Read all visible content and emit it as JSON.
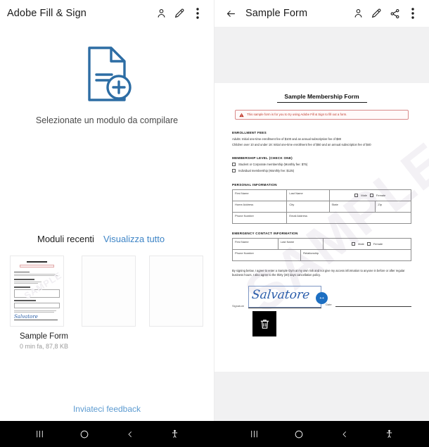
{
  "left_app": {
    "title": "Adobe Fill & Sign",
    "icons": [
      "person-icon",
      "pen-icon",
      "overflow-menu-icon"
    ],
    "empty_state": {
      "icon": "document-add-icon",
      "message": "Selezionate un modulo da compilare",
      "icon_color": "#2d6da4"
    },
    "recent": {
      "title": "Moduli recenti",
      "view_all": "Visualizza tutto",
      "link_color": "#3d84c6",
      "cards": [
        {
          "name": "Sample Form",
          "meta": "0 min fa, 87,8 KB",
          "has_thumbnail": true
        },
        {
          "name": "",
          "meta": "",
          "has_thumbnail": false
        },
        {
          "name": "",
          "meta": "",
          "has_thumbnail": false
        }
      ]
    },
    "feedback_link": "Inviateci feedback"
  },
  "right_app": {
    "back_icon": "back-arrow-icon",
    "title": "Sample Form",
    "icons": [
      "person-icon",
      "pen-icon",
      "share-icon",
      "overflow-menu-icon"
    ],
    "document": {
      "watermark": "SAMPLE",
      "title": "Sample Membership Form",
      "alert": {
        "icon": "warning-triangle-icon",
        "text": "This sample form is for you to try using Adobe Fill & Sign to fill out a form.",
        "color": "#c0392b"
      },
      "enrollment": {
        "heading": "ENROLLMENT FEES",
        "lines": [
          "Adults: Initial one-time enrollment fee of $100 and an annual subscription fee of $80",
          "Children over 10 and under 18: Initial one-time enrollment fee of $50 and an annual subscription fee of $40"
        ]
      },
      "membership": {
        "heading": "MEMBERSHIP LEVEL (CHECK ONE)",
        "options": [
          "Student or Corporate membership (Monthly fee: $75)",
          "Individual membership (Monthly fee: $125)"
        ]
      },
      "personal": {
        "heading": "PERSONAL INFORMATION",
        "fields": {
          "first_name": "First Name",
          "last_name": "Last Name",
          "male": "Male",
          "female": "Female",
          "home_address": "Home Address",
          "city": "City",
          "state": "State",
          "zip": "Zip",
          "phone": "Phone Number",
          "email": "Email Address"
        }
      },
      "emergency": {
        "heading": "EMERGENCY CONTACT INFORMATION",
        "fields": {
          "first_name": "First Name",
          "last_name": "Last Name",
          "male": "Male",
          "female": "Female",
          "phone": "Phone Number",
          "relationship": "Relationship"
        }
      },
      "agreement": "By signing below, I agree to enter a Sample Gym at my own risk and not give my access information to anyone in before or after regular business hours. I also agree to the thirty (30) days cancellation policy.",
      "signature": {
        "label": "Signature",
        "value": "Salvatore",
        "ink_color": "#2a5caa",
        "handle_icon": "resize-horizontal-icon",
        "handle_glyph": "↔",
        "handle_color": "#1d6fc2"
      },
      "date": {
        "label": "Date",
        "value": ""
      },
      "delete_button": {
        "icon": "trash-icon",
        "label": ""
      }
    }
  },
  "navbars": [
    {
      "recents": "recents-icon",
      "home": "home-icon",
      "back": "back-icon",
      "accessibility": "accessibility-icon"
    },
    {
      "recents": "recents-icon",
      "home": "home-icon",
      "back": "back-icon",
      "accessibility": "accessibility-icon"
    }
  ]
}
